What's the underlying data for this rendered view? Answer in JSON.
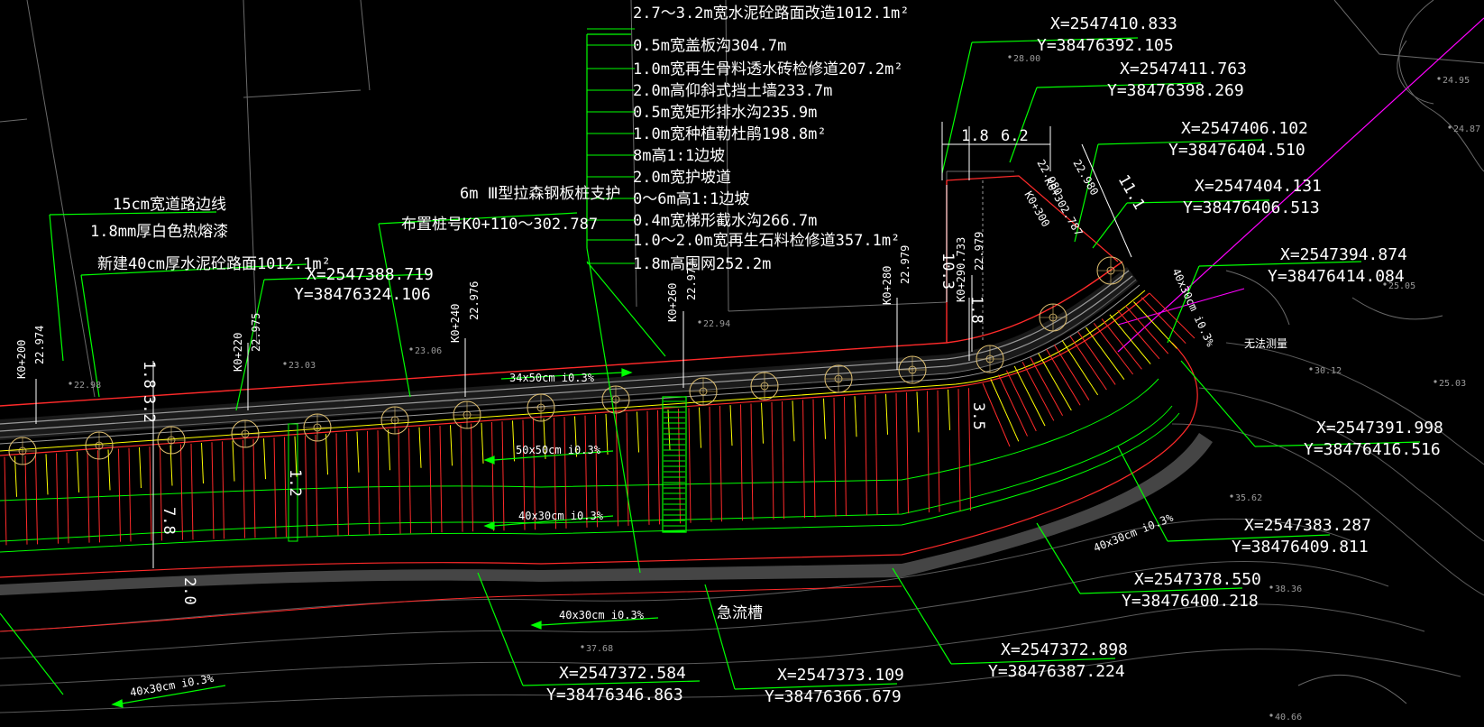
{
  "callouts": {
    "materials": [
      "2.7～3.2m宽水泥砼路面改造1012.1m²",
      "0.5m宽盖板沟304.7m",
      "1.0m宽再生骨料透水砖检修道207.2m²",
      "2.0m高仰斜式挡土墙233.7m",
      "0.5m宽矩形排水沟235.9m",
      "1.0m宽种植勒杜鹃198.8m²",
      "8m高1:1边坡",
      "2.0m宽护坡道",
      "0～6m高1:1边坡",
      "0.4m宽梯形截水沟266.7m",
      "1.0～2.0m宽再生石料检修道357.1m²",
      "1.8m高围网252.2m"
    ],
    "road": [
      "15cm宽道路边线",
      "1.8mm厚白色热熔漆",
      "新建40cm厚水泥砼路面1012.1m²"
    ],
    "sheet_pile": [
      "6m Ⅲ型拉森钢板桩支护",
      "布置桩号K0+110～302.787"
    ]
  },
  "coordinates": [
    {
      "x": "X=2547388.719",
      "y": "Y=38476324.106"
    },
    {
      "x": "X=2547410.833",
      "y": "Y=38476392.105"
    },
    {
      "x": "X=2547411.763",
      "y": "Y=38476398.269"
    },
    {
      "x": "X=2547406.102",
      "y": "Y=38476404.510"
    },
    {
      "x": "X=2547404.131",
      "y": "Y=38476406.513"
    },
    {
      "x": "X=2547394.874",
      "y": "Y=38476414.084"
    },
    {
      "x": "X=2547391.998",
      "y": "Y=38476416.516"
    },
    {
      "x": "X=2547383.287",
      "y": "Y=38476409.811"
    },
    {
      "x": "X=2547378.550",
      "y": "Y=38476400.218"
    },
    {
      "x": "X=2547372.898",
      "y": "Y=38476387.224"
    },
    {
      "x": "X=2547373.109",
      "y": "Y=38476366.679"
    },
    {
      "x": "X=2547372.584",
      "y": "Y=38476346.863"
    }
  ],
  "stations": [
    {
      "k": "K0+200",
      "h": "22.974"
    },
    {
      "k": "K0+220",
      "h": "22.975"
    },
    {
      "k": "K0+240",
      "h": "22.976"
    },
    {
      "k": "K0+260",
      "h": "22.977"
    },
    {
      "k": "K0+280",
      "h": "22.979"
    },
    {
      "k": "K0+290.733",
      "h": "22.979"
    },
    {
      "k": "K0+300",
      "h": "22.980"
    },
    {
      "k": "K0+302.787",
      "h": "22.980"
    }
  ],
  "ditches": [
    "34x50cm i0.3%",
    "50x50cm i0.3%",
    "40x30cm i0.3%",
    "40x30cm i0.3%",
    "40x30cm i0.3%",
    "40x30cm i0.3%",
    "40x30cm i0.3%"
  ],
  "dimensions": [
    "1.8",
    "6.2",
    "11.1",
    "10.3",
    "1.8",
    "1.8",
    "7.8",
    "1.2",
    "2.0",
    "3.2",
    "3.5"
  ],
  "notes": {
    "rapid_trough": "急流槽",
    "unmeasurable": "无法测量"
  },
  "elevations": [
    "23.03",
    "23.06",
    "22.94",
    "22.98",
    "24.95",
    "24.87",
    "25.03",
    "30.12",
    "35.62",
    "37.68",
    "38.36",
    "40.66",
    "28.00",
    "25.05"
  ],
  "colors": {
    "background": "#000000",
    "text": "#ffffff",
    "leader": "#00ff00",
    "red": "#ff2a2a",
    "yellow": "#ffff00",
    "magenta": "#ff00ff",
    "gray": "#8a8a8a",
    "circle": "#e0c070"
  }
}
